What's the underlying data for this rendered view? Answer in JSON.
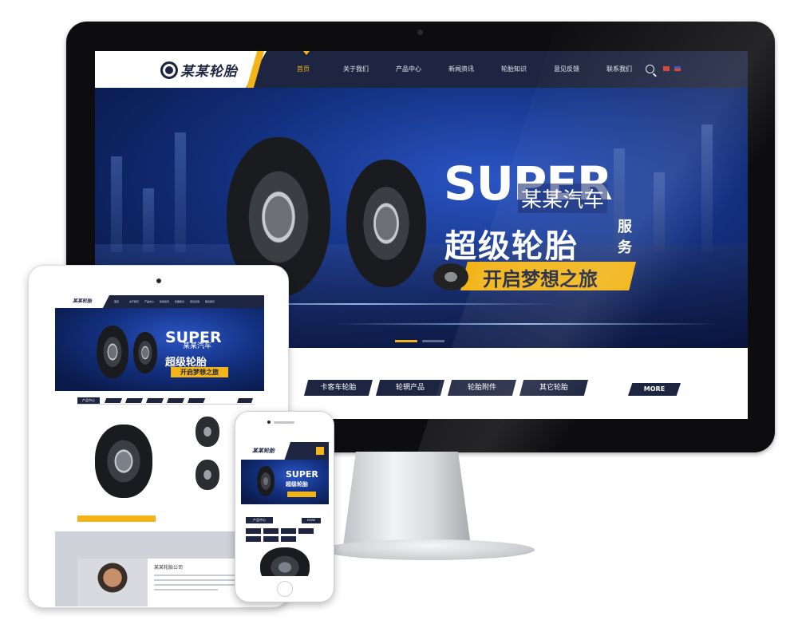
{
  "desktop": {
    "logo_text": "某某轮胎",
    "nav": [
      "首页",
      "关于我们",
      "产品中心",
      "新闻资讯",
      "轮胎知识",
      "意见反馈",
      "联系我们"
    ],
    "nav_active_index": 0,
    "banner": {
      "headline": "SUPER",
      "line1": "某某汽车",
      "line2": "超级轮胎",
      "line2_side": "服务",
      "cta": "开启梦想之旅",
      "active_slide": 1
    },
    "categories": [
      "卡客车轮胎",
      "轮辋产品",
      "轮胎附件",
      "其它轮胎"
    ],
    "more_label": "MORE"
  },
  "tablet": {
    "logo_text": "某某轮胎",
    "banner": {
      "headline": "SUPER",
      "line1": "某某汽车",
      "line2": "超级轮胎",
      "cta": "开启梦想之旅"
    },
    "section_title": "产品中心",
    "about_title": "某某轮胎公司"
  },
  "phone": {
    "logo_text": "某某轮胎",
    "banner": {
      "headline": "SUPER",
      "line2": "超级轮胎"
    },
    "section_title": "产品中心",
    "more_label": "MORE"
  },
  "colors": {
    "navy": "#1e2540",
    "accent": "#f2b418",
    "banner_blue": "#13307f"
  }
}
